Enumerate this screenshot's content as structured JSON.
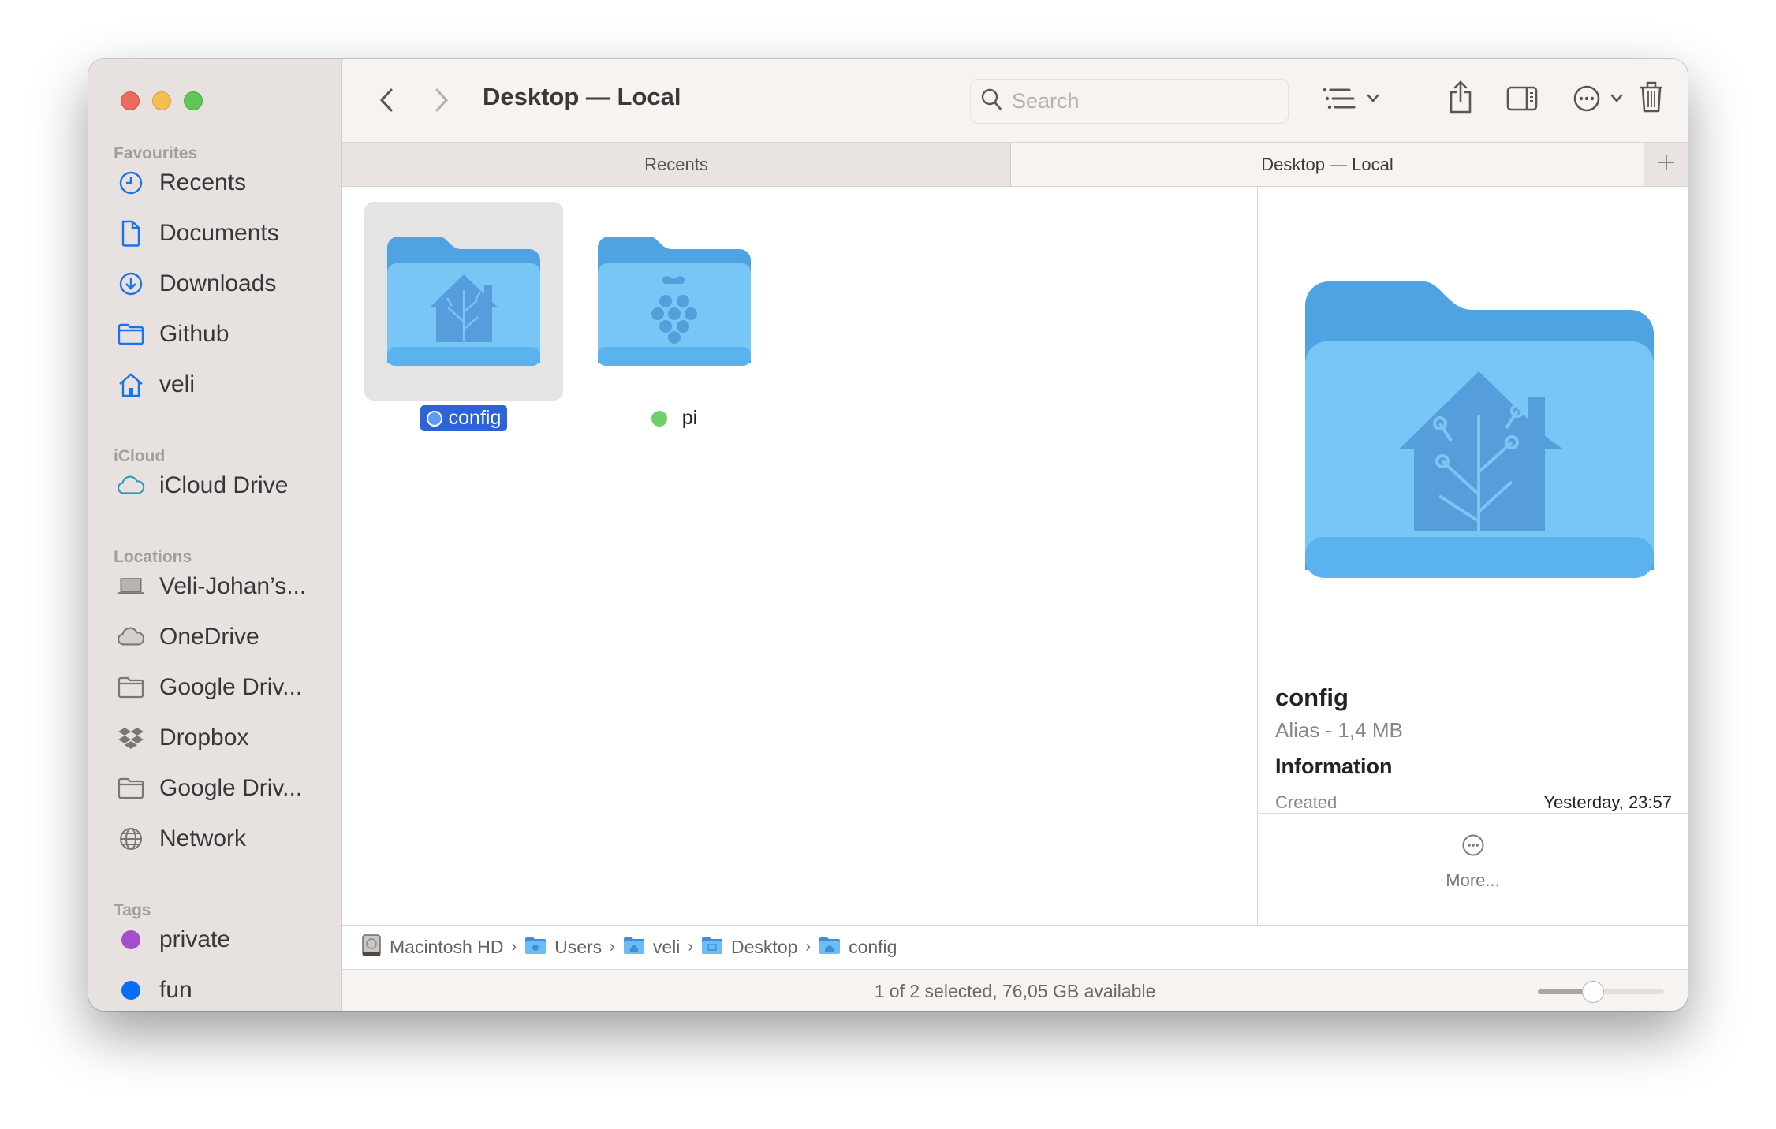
{
  "window": {
    "title": "Desktop — Local"
  },
  "sidebar": {
    "sections": [
      {
        "label": "Favourites",
        "items": [
          {
            "label": "Recents",
            "icon": "clock-icon"
          },
          {
            "label": "Documents",
            "icon": "document-icon"
          },
          {
            "label": "Downloads",
            "icon": "download-icon"
          },
          {
            "label": "Github",
            "icon": "folder-icon"
          },
          {
            "label": "veli",
            "icon": "home-icon"
          }
        ]
      },
      {
        "label": "iCloud",
        "items": [
          {
            "label": "iCloud Drive",
            "icon": "cloud-icon"
          }
        ]
      },
      {
        "label": "Locations",
        "items": [
          {
            "label": "Veli-Johan’s...",
            "icon": "laptop-icon"
          },
          {
            "label": "OneDrive",
            "icon": "cloud-icon"
          },
          {
            "label": "Google Driv...",
            "icon": "folder-icon"
          },
          {
            "label": "Dropbox",
            "icon": "dropbox-icon"
          },
          {
            "label": "Google Driv...",
            "icon": "folder-icon"
          },
          {
            "label": "Network",
            "icon": "globe-icon"
          }
        ]
      },
      {
        "label": "Tags",
        "items": [
          {
            "label": "private",
            "color": "#a34fca"
          },
          {
            "label": "fun",
            "color": "#0a6ef5"
          }
        ]
      }
    ]
  },
  "toolbar": {
    "back_icon": "chevron-left-icon",
    "forward_icon": "chevron-right-icon",
    "search_placeholder": "Search",
    "search_value": "",
    "view_icon": "list-view-icon",
    "share_icon": "share-icon",
    "preview_toggle_icon": "sidebar-right-icon",
    "more_icon": "ellipsis-circle-icon",
    "trash_icon": "trash-icon"
  },
  "tabs": [
    {
      "label": "Recents",
      "active": false
    },
    {
      "label": "Desktop — Local",
      "active": true
    }
  ],
  "files": [
    {
      "name": "config",
      "selected": true,
      "tags": [
        "#5b9bf5"
      ],
      "badge": "home-assistant-icon"
    },
    {
      "name": "pi",
      "selected": false,
      "tags": [
        "#6fcf6a",
        "#ec5f50"
      ],
      "badge": "raspberry-pi-icon"
    }
  ],
  "preview": {
    "name": "config",
    "kind": "Alias - 1,4 MB",
    "info_heading": "Information",
    "rows": [
      {
        "key": "Created",
        "value": "Yesterday, 23:57"
      }
    ],
    "more_label": "More..."
  },
  "pathbar": [
    {
      "label": "Macintosh HD",
      "icon": "hard-drive-icon"
    },
    {
      "label": "Users",
      "icon": "users-folder-icon"
    },
    {
      "label": "veli",
      "icon": "home-folder-icon"
    },
    {
      "label": "Desktop",
      "icon": "desktop-folder-icon"
    },
    {
      "label": "config",
      "icon": "config-folder-icon"
    }
  ],
  "status": {
    "text": "1 of 2 selected, 76,05 GB available",
    "icon_size_slider": 0.44
  },
  "colors": {
    "accent": "#2c63d6",
    "sidebar_icon": "#1a73e8",
    "folder": "#6fbff2"
  }
}
